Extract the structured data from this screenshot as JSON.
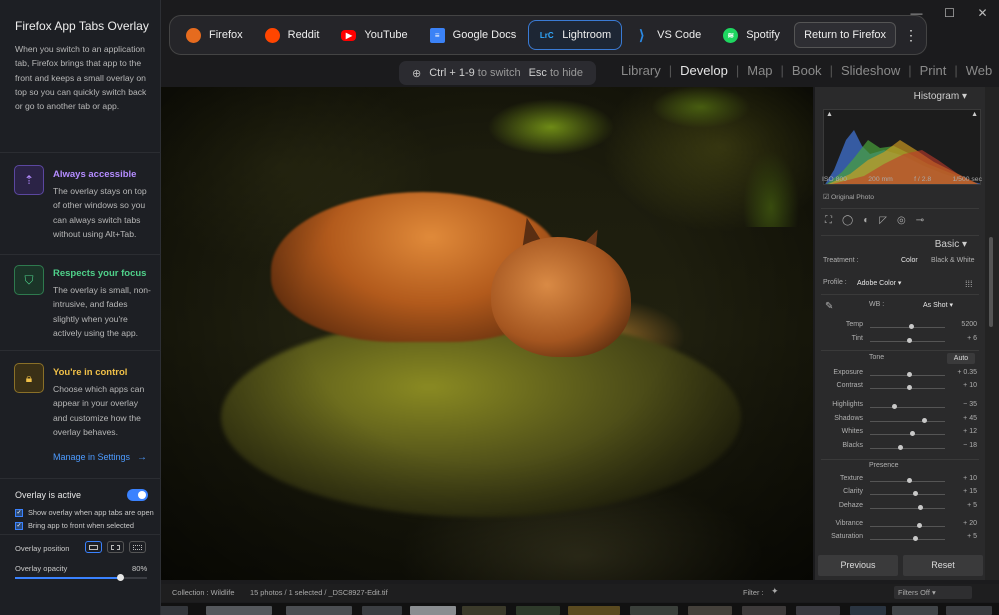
{
  "overlay": {
    "title": "Firefox App Tabs Overlay",
    "description": "When you switch to an application tab, Firefox brings that app to the front and keeps a small overlay on top so you can quickly switch back or go to another tab or app.",
    "features": [
      {
        "title": "Always accessible",
        "text": "The overlay stays on top of other windows so you can always switch tabs without using Alt+Tab.",
        "color": "#b48cff"
      },
      {
        "title": "Respects your focus",
        "text": "The overlay is small, non-intrusive, and fades slightly when you're actively using the app.",
        "color": "#4fd18a"
      },
      {
        "title": "You're in control",
        "text": "Choose which apps can appear in your overlay and customize how the overlay behaves.",
        "color": "#f0c048"
      }
    ],
    "manage_link": "Manage in Settings",
    "active_label": "Overlay is active",
    "checkbox_show": "Show overlay when app tabs are open",
    "checkbox_bring": "Bring app to front when selected",
    "position_label": "Overlay position",
    "opacity_label": "Overlay opacity",
    "opacity_value": "80%",
    "opacity_fraction": 0.8
  },
  "tabs": [
    {
      "label": "Firefox",
      "icon": "firefox-icon",
      "color": "#e66b1e",
      "glyph": ""
    },
    {
      "label": "Reddit",
      "icon": "reddit-icon",
      "color": "#ff4500",
      "glyph": ""
    },
    {
      "label": "YouTube",
      "icon": "youtube-icon",
      "color": "#ff0000",
      "glyph": "▶"
    },
    {
      "label": "Google Docs",
      "icon": "google-docs-icon",
      "color": "#3b82f6",
      "glyph": "≡"
    },
    {
      "label": "Lightroom",
      "icon": "lightroom-icon",
      "color": "#31a8ff",
      "glyph": "LrC"
    },
    {
      "label": "VS Code",
      "icon": "vscode-icon",
      "color": "#2b8ae6",
      "glyph": "⟩"
    },
    {
      "label": "Spotify",
      "icon": "spotify-icon",
      "color": "#1ed760",
      "glyph": "≋"
    }
  ],
  "return_button": "Return to Firefox",
  "hint": {
    "shortcut1": "Ctrl + 1-9",
    "text1": "to switch",
    "shortcut2": "Esc",
    "text2": "to hide"
  },
  "modules": [
    "Library",
    "Develop",
    "Map",
    "Book",
    "Slideshow",
    "Print",
    "Web"
  ],
  "active_module": "Develop",
  "panel": {
    "histogram_title": "Histogram",
    "iso": "ISO 800",
    "focal": "200 mm",
    "aperture": "f / 2.8",
    "shutter": "1/500 sec",
    "original_photo": "Original Photo",
    "basic_title": "Basic",
    "treatment_label": "Treatment :",
    "treatment_color": "Color",
    "treatment_bw": "Black & White",
    "profile_label": "Profile :",
    "profile_value": "Adobe Color",
    "wb_label": "WB :",
    "wb_value": "As Shot",
    "tone_label": "Tone",
    "auto_label": "Auto",
    "presence_label": "Presence",
    "sliders_wb": [
      {
        "label": "Temp",
        "value": "5200",
        "pos": 0.55
      },
      {
        "label": "Tint",
        "value": "+ 6",
        "pos": 0.52
      }
    ],
    "sliders_tone": [
      {
        "label": "Exposure",
        "value": "+ 0.35",
        "pos": 0.52
      },
      {
        "label": "Contrast",
        "value": "+ 10",
        "pos": 0.53
      },
      {
        "label": "Highlights",
        "value": "− 35",
        "pos": 0.32
      },
      {
        "label": "Shadows",
        "value": "+ 45",
        "pos": 0.72
      },
      {
        "label": "Whites",
        "value": "+ 12",
        "pos": 0.56
      },
      {
        "label": "Blacks",
        "value": "− 18",
        "pos": 0.41
      }
    ],
    "sliders_presence": [
      {
        "label": "Texture",
        "value": "+ 10",
        "pos": 0.53
      },
      {
        "label": "Clarity",
        "value": "+ 15",
        "pos": 0.6
      },
      {
        "label": "Dehaze",
        "value": "+ 5",
        "pos": 0.67
      },
      {
        "label": "Vibrance",
        "value": "+ 20",
        "pos": 0.66
      },
      {
        "label": "Saturation",
        "value": "+ 5",
        "pos": 0.6
      }
    ],
    "previous": "Previous",
    "reset": "Reset"
  },
  "bottom": {
    "collection": "Collection : Wildlife",
    "count": "15 photos / 1 selected / _DSC8927-Edit.tif",
    "filter_label": "Filter :",
    "filter_value": "Filters Off"
  }
}
